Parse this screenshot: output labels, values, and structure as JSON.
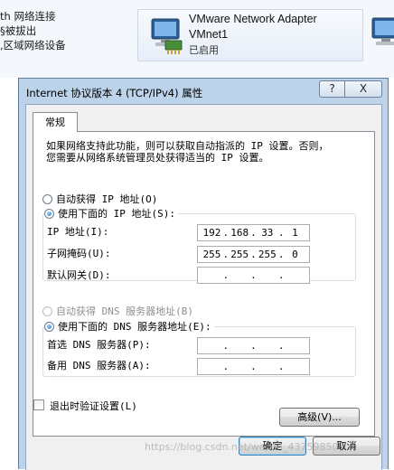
{
  "background_window": {
    "left_lines": [
      "th 网络连接",
      "§被拔出",
      ",区域网络设备"
    ],
    "adapter": {
      "name_line1": "VMware Network Adapter",
      "name_line2": "VMnet1",
      "status": "已启用"
    }
  },
  "dialog": {
    "title": "Internet 协议版本 4 (TCP/IPv4) 属性",
    "help_label": "?",
    "close_label": "X",
    "tab_general": "常规",
    "description_line1": "如果网络支持此功能，则可以获取自动指派的 IP 设置。否则，",
    "description_line2": "您需要从网络系统管理员处获得适当的 IP 设置。",
    "ip_section": {
      "auto_label": "自动获得 IP 地址(O)",
      "manual_label": "使用下面的 IP 地址(S):",
      "selected": "manual",
      "ip_address_label": "IP 地址(I):",
      "ip_address": [
        "192",
        "168",
        "33",
        "1"
      ],
      "subnet_label": "子网掩码(U):",
      "subnet": [
        "255",
        "255",
        "255",
        "0"
      ],
      "gateway_label": "默认网关(D):",
      "gateway": [
        "",
        "",
        "",
        ""
      ]
    },
    "dns_section": {
      "auto_label": "自动获得 DNS 服务器地址(B)",
      "manual_label": "使用下面的 DNS 服务器地址(E):",
      "selected": "manual",
      "preferred_label": "首选 DNS 服务器(P):",
      "preferred": [
        "",
        "",
        "",
        ""
      ],
      "alternate_label": "备用 DNS 服务器(A):",
      "alternate": [
        "",
        "",
        "",
        ""
      ]
    },
    "validate_on_exit_label": "退出时验证设置(L)",
    "validate_on_exit_checked": false,
    "advanced_label": "高级(V)...",
    "ok_label": "确定",
    "cancel_label": "取消"
  },
  "watermark": "https://blog.csdn.net/weixin_43759850"
}
